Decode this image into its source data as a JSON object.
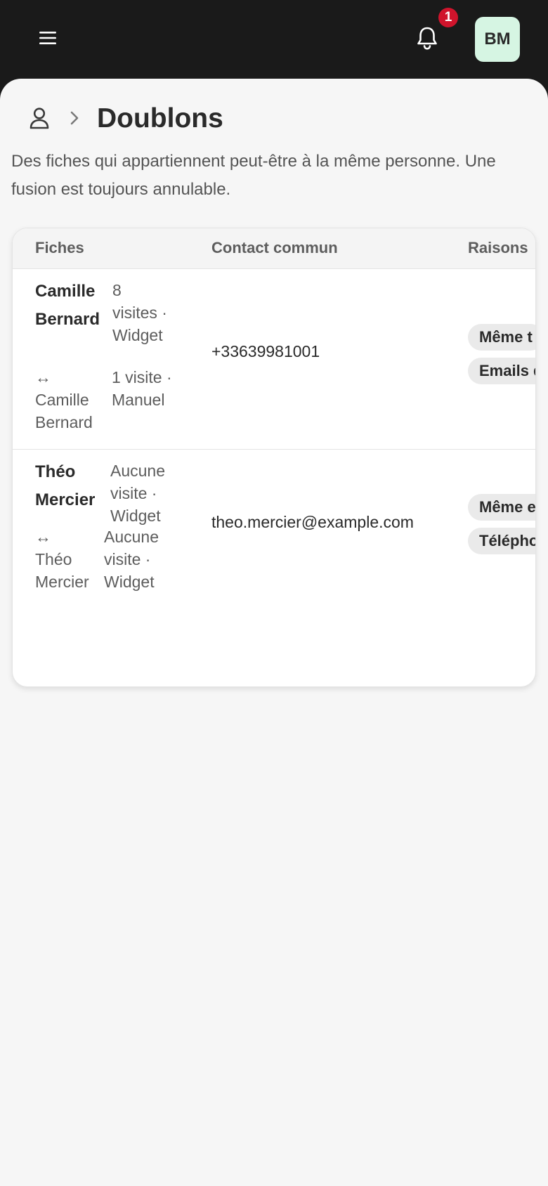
{
  "header": {
    "menu_icon": "hamburger-menu-icon",
    "bell_icon": "bell-icon",
    "notification_count": "1",
    "avatar_initials": "BM",
    "colors": {
      "background": "#1a1a1a",
      "badge": "#d0142c",
      "avatar_bg": "#d6f5e3"
    }
  },
  "breadcrumb": {
    "root_icon": "person-icon",
    "separator_icon": "chevron-right-icon"
  },
  "page": {
    "title": "Doublons",
    "subtitle": "Des fiches qui appartiennent peut-être à la même personne. Une fusion est toujours annulable."
  },
  "table": {
    "columns": [
      "Fiches",
      "Contact commun",
      "Raisons"
    ],
    "rows": [
      {
        "primary_name": "Camille Bernard",
        "primary_meta": "8 visites · Widget",
        "duplicate_prefix": "↔",
        "duplicate_name": "Camille Bernard",
        "duplicate_meta": "1 visite · Manuel",
        "contact": "+33639981001",
        "reasons": [
          "Même t",
          "Emails d"
        ]
      },
      {
        "primary_name": "Théo Mercier",
        "primary_meta": "Aucune visite · Widget",
        "duplicate_prefix": "↔",
        "duplicate_name": "Théo Mercier",
        "duplicate_meta": "Aucune visite · Widget",
        "contact": "theo.mercier@example.com",
        "reasons": [
          "Même e",
          "Télépho"
        ]
      }
    ]
  }
}
